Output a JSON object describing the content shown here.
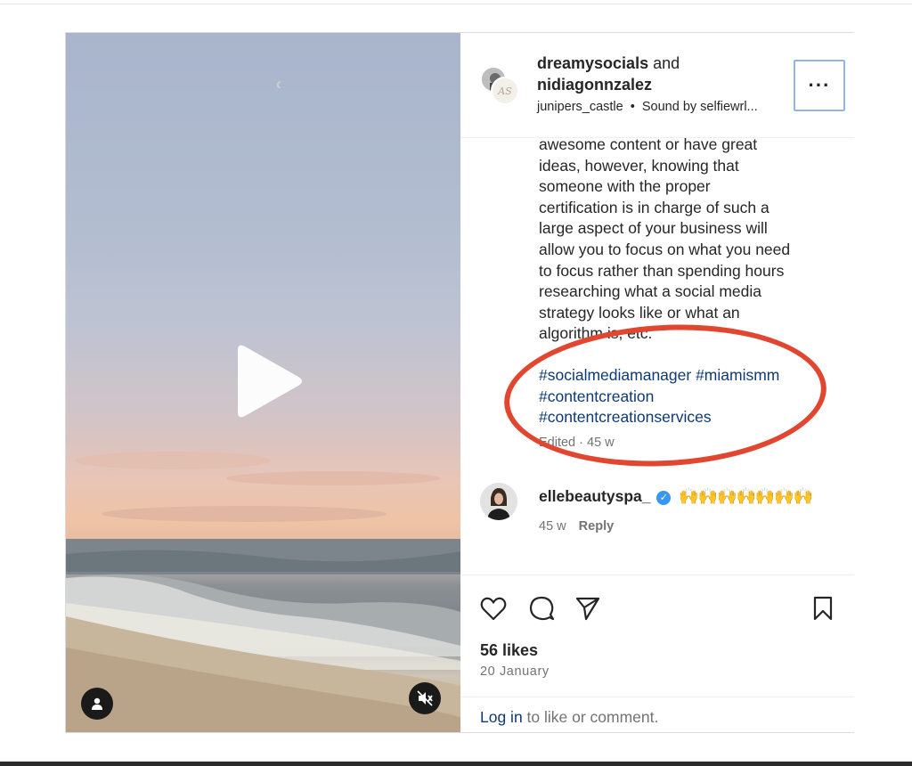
{
  "post": {
    "header": {
      "user1": "dreamysocials",
      "joiner": "and",
      "user2": "nidiagonnzalez",
      "location": "junipers_castle",
      "separator": "•",
      "audio": "Sound by selfiewrl...",
      "more_icon": "ellipsis-icon",
      "more_label": "···"
    },
    "caption": {
      "lines": [
        "awesome content or have great",
        "ideas, however, knowing that",
        "someone with the proper",
        "certification is in charge of such a",
        "large aspect of your business will",
        "allow you to focus on what you need",
        "to focus rather than spending hours",
        "researching what a social media",
        "strategy looks like or what an",
        "algorithm is, etc."
      ],
      "hashtags": [
        "#socialmediamanager #miamismm",
        "#contentcreation",
        "#contentcreationservices"
      ],
      "edited": "Edited · 45 w"
    },
    "comment": {
      "username": "ellebeautyspa_",
      "verified_icon": "verified-badge-icon",
      "text": "🙌🙌🙌🙌🙌🙌🙌",
      "age": "45 w",
      "reply_label": "Reply"
    },
    "actions": {
      "like_icon": "heart-icon",
      "comment_icon": "comment-bubble-icon",
      "share_icon": "paper-plane-icon",
      "save_icon": "bookmark-icon"
    },
    "likes": "56 likes",
    "date": "20 January",
    "login": {
      "link": "Log in",
      "rest": " to like or comment."
    }
  },
  "media": {
    "play_icon": "play-icon",
    "user_tag_icon": "user-icon",
    "mute_icon": "speaker-muted-icon"
  },
  "colors": {
    "link": "#0e3a73",
    "annotation_circle": "#e14631",
    "focus_outline": "#93b6e8",
    "verified": "#3897f0"
  }
}
